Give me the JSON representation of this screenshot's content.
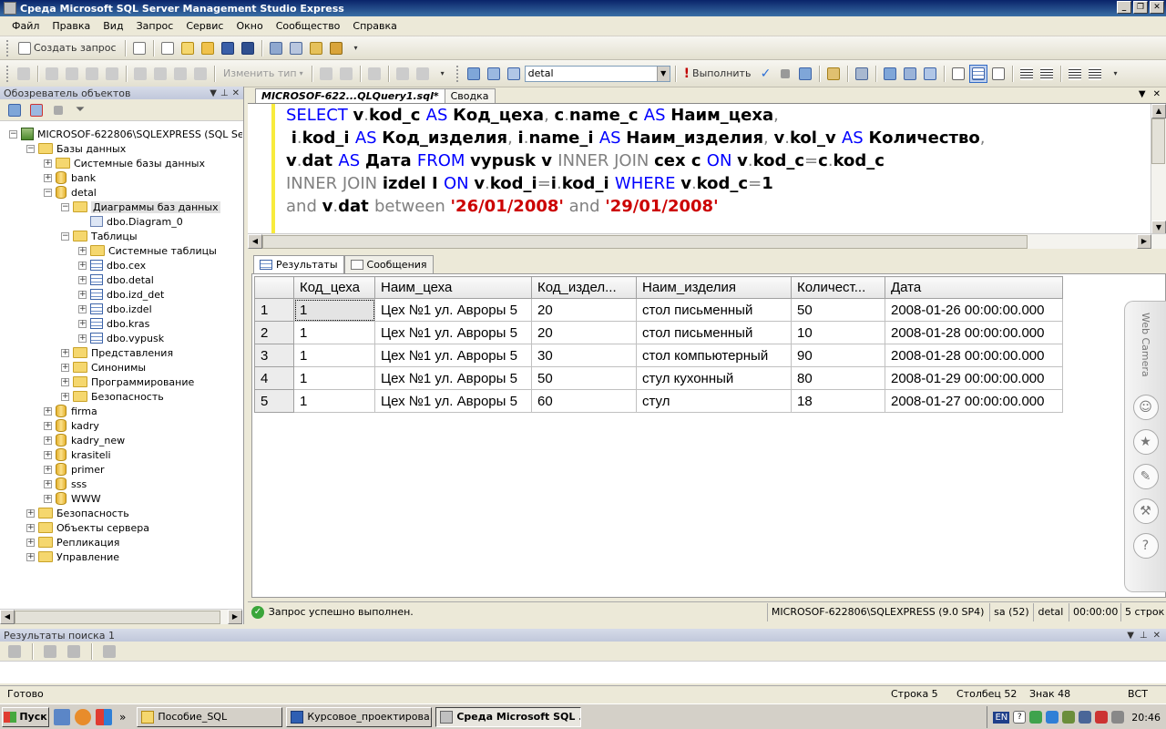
{
  "window": {
    "title": "Среда Microsoft SQL Server Management Studio Express"
  },
  "menu": [
    "Файл",
    "Правка",
    "Вид",
    "Запрос",
    "Сервис",
    "Окно",
    "Сообщество",
    "Справка"
  ],
  "toolbar1": {
    "new_query_label": "Создать запрос"
  },
  "toolbar2": {
    "change_type_label": "Изменить тип",
    "database_value": "detal",
    "execute_label": "Выполнить"
  },
  "object_explorer": {
    "title": "Обозреватель объектов",
    "tree": [
      {
        "label": "MICROSOF-622806\\SQLEXPRESS (SQL Server",
        "icon": "server",
        "expander": "-",
        "level": 0
      },
      {
        "label": "Базы данных",
        "icon": "folder",
        "expander": "-",
        "level": 1
      },
      {
        "label": "Системные базы данных",
        "icon": "folder",
        "expander": "+",
        "level": 2
      },
      {
        "label": "bank",
        "icon": "db",
        "expander": "+",
        "level": 2
      },
      {
        "label": "detal",
        "icon": "db",
        "expander": "-",
        "level": 2
      },
      {
        "label": "Диаграммы баз данных",
        "icon": "folder",
        "expander": "-",
        "level": 3,
        "selected": true
      },
      {
        "label": "dbo.Diagram_0",
        "icon": "diagram",
        "expander": "",
        "level": 4
      },
      {
        "label": "Таблицы",
        "icon": "folder",
        "expander": "-",
        "level": 3
      },
      {
        "label": "Системные таблицы",
        "icon": "folder",
        "expander": "+",
        "level": 4
      },
      {
        "label": "dbo.cex",
        "icon": "table",
        "expander": "+",
        "level": 4
      },
      {
        "label": "dbo.detal",
        "icon": "table",
        "expander": "+",
        "level": 4
      },
      {
        "label": "dbo.izd_det",
        "icon": "table",
        "expander": "+",
        "level": 4
      },
      {
        "label": "dbo.izdel",
        "icon": "table",
        "expander": "+",
        "level": 4
      },
      {
        "label": "dbo.kras",
        "icon": "table",
        "expander": "+",
        "level": 4
      },
      {
        "label": "dbo.vypusk",
        "icon": "table",
        "expander": "+",
        "level": 4
      },
      {
        "label": "Представления",
        "icon": "folder",
        "expander": "+",
        "level": 3
      },
      {
        "label": "Синонимы",
        "icon": "folder",
        "expander": "+",
        "level": 3
      },
      {
        "label": "Программирование",
        "icon": "folder",
        "expander": "+",
        "level": 3
      },
      {
        "label": "Безопасность",
        "icon": "folder",
        "expander": "+",
        "level": 3
      },
      {
        "label": "firma",
        "icon": "db",
        "expander": "+",
        "level": 2
      },
      {
        "label": "kadry",
        "icon": "db",
        "expander": "+",
        "level": 2
      },
      {
        "label": "kadry_new",
        "icon": "db",
        "expander": "+",
        "level": 2
      },
      {
        "label": "krasiteli",
        "icon": "db",
        "expander": "+",
        "level": 2
      },
      {
        "label": "primer",
        "icon": "db",
        "expander": "+",
        "level": 2
      },
      {
        "label": "sss",
        "icon": "db",
        "expander": "+",
        "level": 2
      },
      {
        "label": "WWW",
        "icon": "db",
        "expander": "+",
        "level": 2
      },
      {
        "label": "Безопасность",
        "icon": "folder",
        "expander": "+",
        "level": 1
      },
      {
        "label": "Объекты сервера",
        "icon": "folder",
        "expander": "+",
        "level": 1
      },
      {
        "label": "Репликация",
        "icon": "folder",
        "expander": "+",
        "level": 1
      },
      {
        "label": "Управление",
        "icon": "folder",
        "expander": "+",
        "level": 1
      }
    ]
  },
  "doc_tabs": [
    "MICROSOF-622...QLQuery1.sql*",
    "Сводка"
  ],
  "editor": {
    "lines": [
      [
        [
          "kw",
          "SELECT "
        ],
        [
          "id",
          "v"
        ],
        [
          "op",
          "."
        ],
        [
          "id",
          "kod_c "
        ],
        [
          "kw",
          "AS "
        ],
        [
          "id",
          "Код_цеха"
        ],
        [
          "op",
          ", "
        ],
        [
          "id",
          "c"
        ],
        [
          "op",
          "."
        ],
        [
          "id",
          "name_c "
        ],
        [
          "kw",
          "AS "
        ],
        [
          "id",
          "Наим_цеха"
        ],
        [
          "op",
          ","
        ]
      ],
      [
        [
          "plain",
          " "
        ],
        [
          "id",
          "i"
        ],
        [
          "op",
          "."
        ],
        [
          "id",
          "kod_i "
        ],
        [
          "kw",
          "AS "
        ],
        [
          "id",
          "Код_изделия"
        ],
        [
          "op",
          ", "
        ],
        [
          "id",
          "i"
        ],
        [
          "op",
          "."
        ],
        [
          "id",
          "name_i "
        ],
        [
          "kw",
          "AS "
        ],
        [
          "id",
          "Наим_изделия"
        ],
        [
          "op",
          ", "
        ],
        [
          "id",
          "v"
        ],
        [
          "op",
          "."
        ],
        [
          "id",
          "kol_v "
        ],
        [
          "kw",
          "AS "
        ],
        [
          "id",
          "Количество"
        ],
        [
          "op",
          ","
        ]
      ],
      [
        [
          "id",
          "v"
        ],
        [
          "op",
          "."
        ],
        [
          "id",
          "dat "
        ],
        [
          "kw",
          "AS "
        ],
        [
          "id",
          "Дата "
        ],
        [
          "kw",
          "FROM "
        ],
        [
          "id",
          "vypusk v "
        ],
        [
          "op",
          "INNER JOIN "
        ],
        [
          "id",
          "cex c "
        ],
        [
          "kw",
          "ON "
        ],
        [
          "id",
          "v"
        ],
        [
          "op",
          "."
        ],
        [
          "id",
          "kod_c"
        ],
        [
          "op",
          "="
        ],
        [
          "id",
          "c"
        ],
        [
          "op",
          "."
        ],
        [
          "id",
          "kod_c"
        ]
      ],
      [
        [
          "op",
          "INNER JOIN "
        ],
        [
          "id",
          "izdel I "
        ],
        [
          "kw",
          "ON "
        ],
        [
          "id",
          "v"
        ],
        [
          "op",
          "."
        ],
        [
          "id",
          "kod_i"
        ],
        [
          "op",
          "="
        ],
        [
          "id",
          "i"
        ],
        [
          "op",
          "."
        ],
        [
          "id",
          "kod_i "
        ],
        [
          "kw",
          "WHERE "
        ],
        [
          "id",
          "v"
        ],
        [
          "op",
          "."
        ],
        [
          "id",
          "kod_c"
        ],
        [
          "op",
          "="
        ],
        [
          "id",
          "1"
        ]
      ],
      [
        [
          "op",
          "and "
        ],
        [
          "id",
          "v"
        ],
        [
          "op",
          "."
        ],
        [
          "id",
          "dat "
        ],
        [
          "op",
          "between "
        ],
        [
          "str",
          "'26/01/2008'"
        ],
        [
          "op",
          " and "
        ],
        [
          "str",
          "'29/01/2008'"
        ]
      ]
    ]
  },
  "result_tabs": {
    "results_label": "Результаты",
    "messages_label": "Сообщения"
  },
  "grid": {
    "columns": [
      "Код_цеха",
      "Наим_цеха",
      "Код_издел...",
      "Наим_изделия",
      "Количест...",
      "Дата"
    ],
    "rows": [
      [
        "1",
        "1",
        "Цех №1 ул. Авроры 5",
        "20",
        "стол письменный",
        "50",
        "2008-01-26 00:00:00.000"
      ],
      [
        "2",
        "1",
        "Цех №1 ул. Авроры 5",
        "20",
        "стол письменный",
        "10",
        "2008-01-28 00:00:00.000"
      ],
      [
        "3",
        "1",
        "Цех №1 ул. Авроры 5",
        "30",
        "стол компьютерный",
        "90",
        "2008-01-28 00:00:00.000"
      ],
      [
        "4",
        "1",
        "Цех №1 ул. Авроры 5",
        "50",
        "стул кухонный",
        "80",
        "2008-01-29 00:00:00.000"
      ],
      [
        "5",
        "1",
        "Цех №1 ул. Авроры 5",
        "60",
        "стул",
        "18",
        "2008-01-27 00:00:00.000"
      ]
    ]
  },
  "side_panel": {
    "label": "Web Camera"
  },
  "query_status": {
    "message": "Запрос успешно выполнен.",
    "server": "MICROSOF-622806\\SQLEXPRESS (9.0 SP4)",
    "user": "sa (52)",
    "database": "detal",
    "elapsed": "00:00:00",
    "rows": "5 строк"
  },
  "search_pane": {
    "title": "Результаты поиска 1"
  },
  "statusbar": {
    "ready": "Готово",
    "line": "Строка 5",
    "column": "Столбец 52",
    "char": "Знак 48",
    "mode": "ВСТ"
  },
  "taskbar": {
    "start_label": "Пуск",
    "tasks": [
      "Пособие_SQL",
      "Курсовое_проектирова...",
      "Среда Microsoft SQL ..."
    ],
    "lang": "EN",
    "time": "20:46"
  }
}
